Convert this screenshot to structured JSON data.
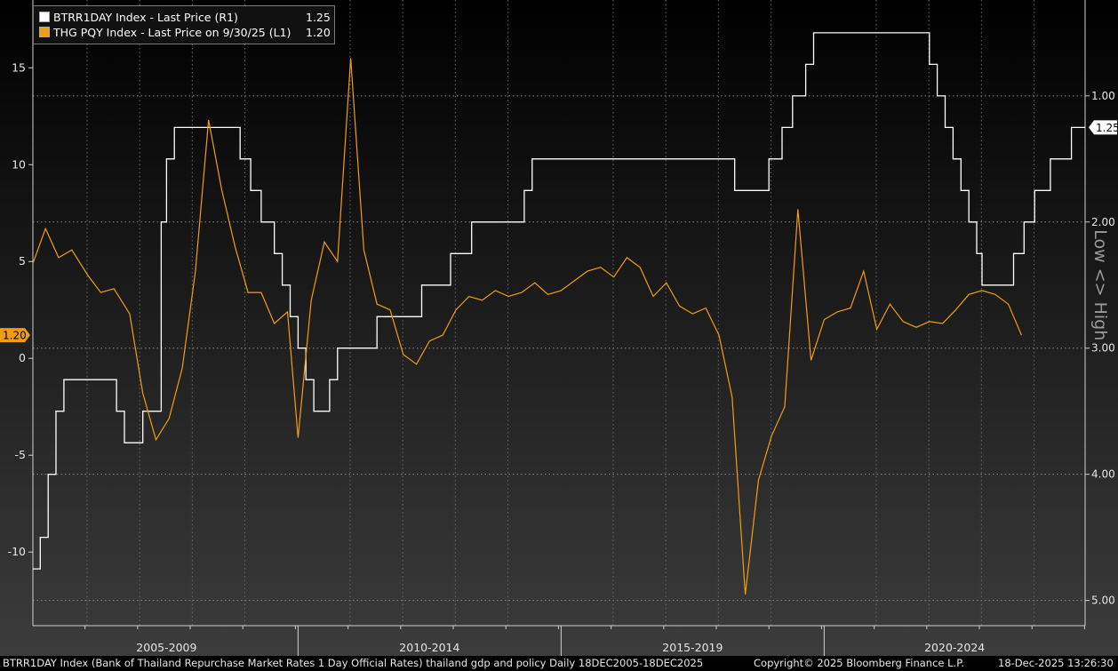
{
  "chart_data": {
    "type": "line",
    "left_axis": {
      "ticks": [
        -10,
        -5,
        0,
        5,
        10,
        15
      ],
      "tick_labels": [
        "-10",
        "-5",
        "0",
        "5",
        "10",
        "15"
      ],
      "ylim": [
        -13.8,
        18.5
      ]
    },
    "right_axis": {
      "ticks": [
        1.0,
        2.0,
        3.0,
        4.0,
        5.0
      ],
      "tick_labels": [
        "1.00",
        "2.00",
        "3.00",
        "4.00",
        "5.00"
      ],
      "inverted": true,
      "ylim": [
        0.24,
        5.2
      ],
      "label": "Low <> High"
    },
    "x_range": [
      2005.96,
      2025.96
    ],
    "periods": [
      {
        "label": "2005-2009",
        "start": 2006.0,
        "end": 2011.0
      },
      {
        "label": "2010-2014",
        "start": 2011.0,
        "end": 2016.0
      },
      {
        "label": "2015-2019",
        "start": 2016.0,
        "end": 2021.0
      },
      {
        "label": "2020-2024",
        "start": 2021.0,
        "end": 2026.0
      }
    ],
    "series": [
      {
        "name": "BTRR1DAY Index - Last Price (R1)",
        "axis": "right",
        "color": "#ffffff",
        "step": true,
        "last_value": "1.25",
        "points": [
          [
            2005.96,
            4.75
          ],
          [
            2006.1,
            4.5
          ],
          [
            2006.25,
            4.0
          ],
          [
            2006.4,
            3.5
          ],
          [
            2006.55,
            3.25
          ],
          [
            2007.55,
            3.5
          ],
          [
            2007.7,
            3.75
          ],
          [
            2008.05,
            3.5
          ],
          [
            2008.4,
            2.0
          ],
          [
            2008.5,
            1.5
          ],
          [
            2008.65,
            1.25
          ],
          [
            2009.9,
            1.5
          ],
          [
            2010.1,
            1.75
          ],
          [
            2010.3,
            2.0
          ],
          [
            2010.55,
            2.25
          ],
          [
            2010.7,
            2.5
          ],
          [
            2010.85,
            2.75
          ],
          [
            2011.0,
            3.0
          ],
          [
            2011.15,
            3.25
          ],
          [
            2011.3,
            3.5
          ],
          [
            2011.6,
            3.25
          ],
          [
            2011.75,
            3.0
          ],
          [
            2012.5,
            2.75
          ],
          [
            2013.35,
            2.5
          ],
          [
            2013.9,
            2.25
          ],
          [
            2014.3,
            2.0
          ],
          [
            2015.3,
            1.75
          ],
          [
            2015.45,
            1.5
          ],
          [
            2019.3,
            1.75
          ],
          [
            2019.95,
            1.5
          ],
          [
            2020.2,
            1.25
          ],
          [
            2020.4,
            1.0
          ],
          [
            2020.65,
            0.75
          ],
          [
            2020.8,
            0.5
          ],
          [
            2023.0,
            0.75
          ],
          [
            2023.15,
            1.0
          ],
          [
            2023.3,
            1.25
          ],
          [
            2023.45,
            1.5
          ],
          [
            2023.6,
            1.75
          ],
          [
            2023.75,
            2.0
          ],
          [
            2023.9,
            2.25
          ],
          [
            2024.0,
            2.5
          ],
          [
            2024.6,
            2.25
          ],
          [
            2024.8,
            2.0
          ],
          [
            2025.0,
            1.75
          ],
          [
            2025.3,
            1.5
          ],
          [
            2025.7,
            1.25
          ],
          [
            2025.96,
            1.25
          ]
        ]
      },
      {
        "name": "THG PQY Index - Last Price on 9/30/25 (L1)",
        "axis": "left",
        "color": "#f39c12",
        "last_value": "1.20",
        "points": [
          [
            2005.96,
            4.9
          ],
          [
            2006.2,
            6.7
          ],
          [
            2006.45,
            5.2
          ],
          [
            2006.7,
            5.6
          ],
          [
            2007.0,
            4.3
          ],
          [
            2007.25,
            3.4
          ],
          [
            2007.5,
            3.6
          ],
          [
            2007.8,
            2.3
          ],
          [
            2008.05,
            -1.8
          ],
          [
            2008.3,
            -4.2
          ],
          [
            2008.55,
            -3.1
          ],
          [
            2008.8,
            -0.5
          ],
          [
            2009.05,
            4.5
          ],
          [
            2009.3,
            12.3
          ],
          [
            2009.55,
            8.7
          ],
          [
            2009.8,
            5.8
          ],
          [
            2010.05,
            3.4
          ],
          [
            2010.3,
            3.4
          ],
          [
            2010.55,
            1.8
          ],
          [
            2010.8,
            2.4
          ],
          [
            2011.0,
            -4.1
          ],
          [
            2011.25,
            3.0
          ],
          [
            2011.5,
            6.0
          ],
          [
            2011.75,
            5.0
          ],
          [
            2012.0,
            15.5
          ],
          [
            2012.25,
            5.6
          ],
          [
            2012.5,
            2.8
          ],
          [
            2012.75,
            2.5
          ],
          [
            2013.0,
            0.2
          ],
          [
            2013.25,
            -0.3
          ],
          [
            2013.5,
            0.9
          ],
          [
            2013.75,
            1.2
          ],
          [
            2014.0,
            2.5
          ],
          [
            2014.25,
            3.2
          ],
          [
            2014.5,
            3.0
          ],
          [
            2014.75,
            3.5
          ],
          [
            2015.0,
            3.2
          ],
          [
            2015.25,
            3.4
          ],
          [
            2015.5,
            3.9
          ],
          [
            2015.75,
            3.3
          ],
          [
            2016.0,
            3.5
          ],
          [
            2016.25,
            4.0
          ],
          [
            2016.5,
            4.5
          ],
          [
            2016.75,
            4.7
          ],
          [
            2017.0,
            4.2
          ],
          [
            2017.25,
            5.2
          ],
          [
            2017.5,
            4.7
          ],
          [
            2017.75,
            3.2
          ],
          [
            2018.0,
            3.9
          ],
          [
            2018.25,
            2.7
          ],
          [
            2018.5,
            2.3
          ],
          [
            2018.75,
            2.6
          ],
          [
            2019.0,
            1.2
          ],
          [
            2019.25,
            -2.0
          ],
          [
            2019.5,
            -12.2
          ],
          [
            2019.75,
            -6.3
          ],
          [
            2020.0,
            -4.0
          ],
          [
            2020.25,
            -2.5
          ],
          [
            2020.5,
            7.7
          ],
          [
            2020.75,
            -0.1
          ],
          [
            2021.0,
            2.0
          ],
          [
            2021.25,
            2.4
          ],
          [
            2021.5,
            2.6
          ],
          [
            2021.75,
            4.5
          ],
          [
            2022.0,
            1.5
          ],
          [
            2022.25,
            2.8
          ],
          [
            2022.5,
            1.9
          ],
          [
            2022.75,
            1.6
          ],
          [
            2023.0,
            1.9
          ],
          [
            2023.25,
            1.8
          ],
          [
            2023.5,
            2.5
          ],
          [
            2023.75,
            3.3
          ],
          [
            2024.0,
            3.5
          ],
          [
            2024.25,
            3.3
          ],
          [
            2024.5,
            2.8
          ],
          [
            2024.75,
            1.2
          ]
        ]
      }
    ]
  },
  "legend": {
    "items": [
      {
        "label": "BTRR1DAY Index - Last Price (R1)",
        "value": "1.25",
        "color": "#ffffff"
      },
      {
        "label": "THG PQY Index - Last Price on 9/30/25 (L1)",
        "value": "1.20",
        "color": "#f39c12"
      }
    ]
  },
  "badges": {
    "left_last": "1.20",
    "right_last": "1.25"
  },
  "footer": {
    "description": "BTRR1DAY Index (Bank of Thailand Repurchase Market Rates 1 Day Official Rates) thailand gdp and policy Daily 18DEC2005-18DEC2025",
    "copyright": "Copyright© 2025 Bloomberg Finance L.P.",
    "timestamp": "18-Dec-2025 13:26:30"
  }
}
